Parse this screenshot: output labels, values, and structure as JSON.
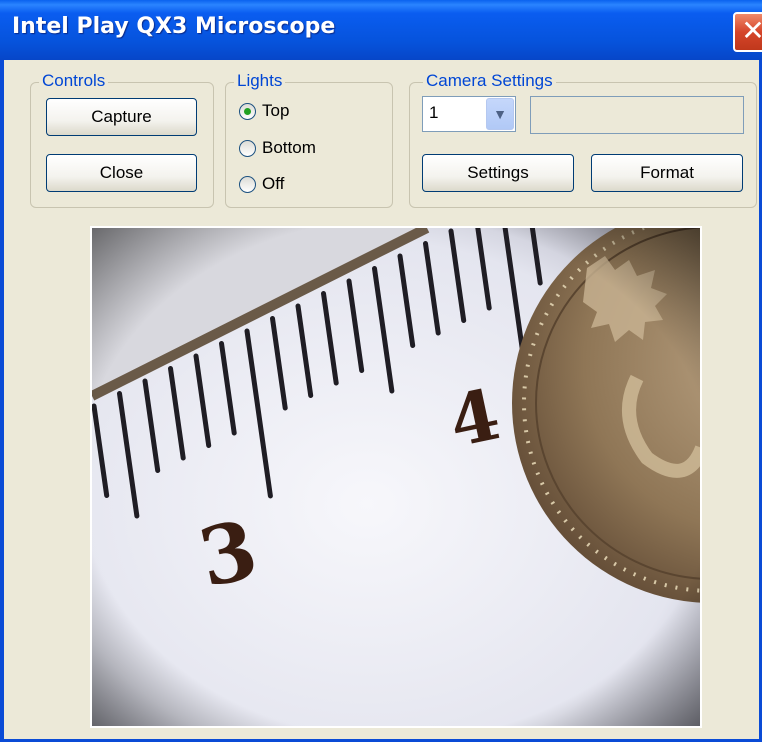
{
  "window": {
    "title": "Intel Play QX3 Microscope",
    "close_glyph": "✕"
  },
  "controls": {
    "label": "Controls",
    "capture_label": "Capture",
    "close_label": "Close"
  },
  "lights": {
    "label": "Lights",
    "options": [
      {
        "label": "Top",
        "checked": true
      },
      {
        "label": "Bottom",
        "checked": false
      },
      {
        "label": "Off",
        "checked": false
      }
    ]
  },
  "camera": {
    "label": "Camera Settings",
    "camera_select_value": "1",
    "info_text": "",
    "settings_label": "Settings",
    "format_label": "Format"
  },
  "view": {
    "ruler_numbers": [
      "3",
      "4"
    ],
    "colors": {
      "paper": "#f1f2f8",
      "ticks": "#1f1d24",
      "numbers": "#3a1e12",
      "coin": "#9c8567"
    }
  }
}
